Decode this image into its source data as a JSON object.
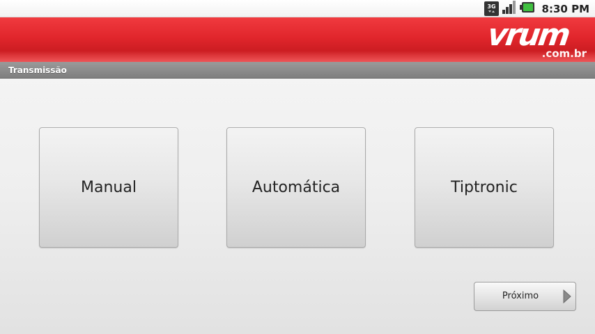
{
  "status_bar": {
    "time": "8:30 PM",
    "network_type": "3G",
    "icons": [
      "3g-icon",
      "signal-icon",
      "battery-icon"
    ],
    "battery_color": "#22aa22"
  },
  "header": {
    "brand_main": "vrum",
    "brand_domain": ".com.br",
    "brand_color": "#e1262c"
  },
  "section": {
    "title": "Transmissão"
  },
  "options": [
    {
      "label": "Manual"
    },
    {
      "label": "Automática"
    },
    {
      "label": "Tiptronic"
    }
  ],
  "navigation": {
    "next_label": "Próximo",
    "next_icon": "chevron-right-icon"
  }
}
